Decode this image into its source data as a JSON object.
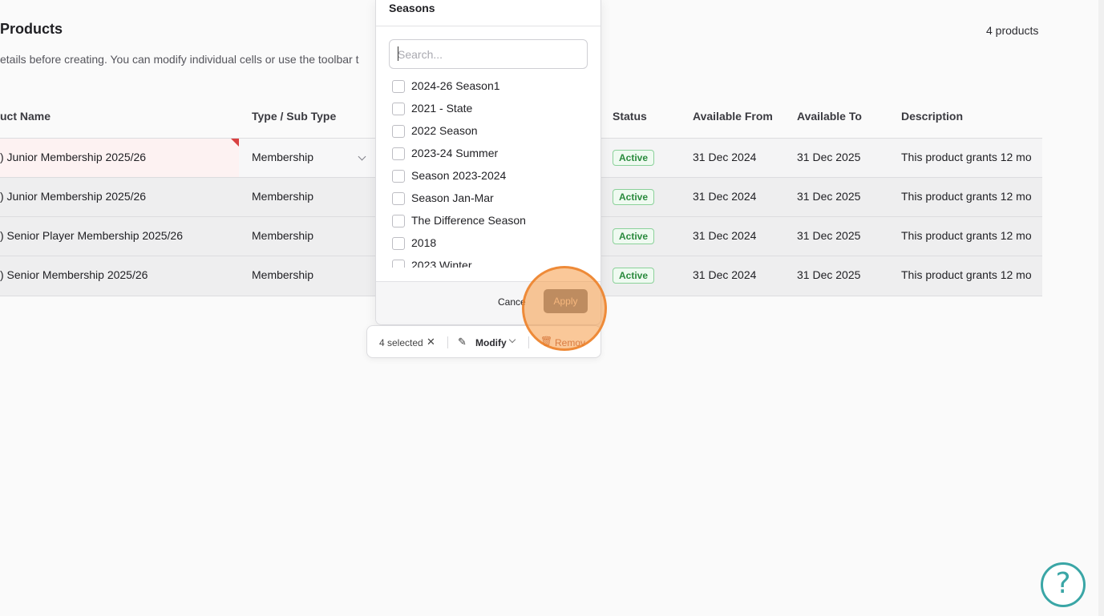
{
  "header": {
    "title": "Products",
    "count": "4 products",
    "subtitle": "etails before creating. You can modify individual cells or use the toolbar t"
  },
  "table": {
    "columns": [
      "uct Name",
      "Type / Sub Type",
      "Status",
      "Available From",
      "Available To",
      "Description"
    ],
    "rows": [
      {
        "name": ") Junior Membership 2025/26",
        "type": "Membership",
        "status": "Active",
        "from": "31 Dec 2024",
        "to": "31 Dec 2025",
        "description": "This product grants 12 mo"
      },
      {
        "name": ") Junior Membership 2025/26",
        "type": "Membership",
        "status": "Active",
        "from": "31 Dec 2024",
        "to": "31 Dec 2025",
        "description": "This product grants 12 mo"
      },
      {
        "name": ") Senior Player Membership 2025/26",
        "type": "Membership",
        "status": "Active",
        "from": "31 Dec 2024",
        "to": "31 Dec 2025",
        "description": "This product grants 12 mo"
      },
      {
        "name": ") Senior Membership 2025/26",
        "type": "Membership",
        "status": "Active",
        "from": "31 Dec 2024",
        "to": "31 Dec 2025",
        "description": "This product grants 12 mo"
      }
    ]
  },
  "popover": {
    "title": "Seasons",
    "search_placeholder": "Search...",
    "options": [
      "2024-26 Season1",
      "2021 - State",
      "2022 Season",
      "2023-24 Summer",
      "Season 2023-2024",
      "Season Jan-Mar",
      "The Difference Season",
      "2018",
      "2023 Winter"
    ],
    "cancel_label": "Cance",
    "apply_label": "Apply"
  },
  "toolbar": {
    "selected_label": "4 selected",
    "clear_icon": "close-icon",
    "modify_label": "Modify",
    "remove_label": "Remov"
  },
  "help": {
    "label": "?"
  },
  "colors": {
    "status_active": "#2a8a3d",
    "help_accent": "#3aa6a6",
    "error_marker": "#d94141",
    "click_highlight": "#f59b46"
  }
}
